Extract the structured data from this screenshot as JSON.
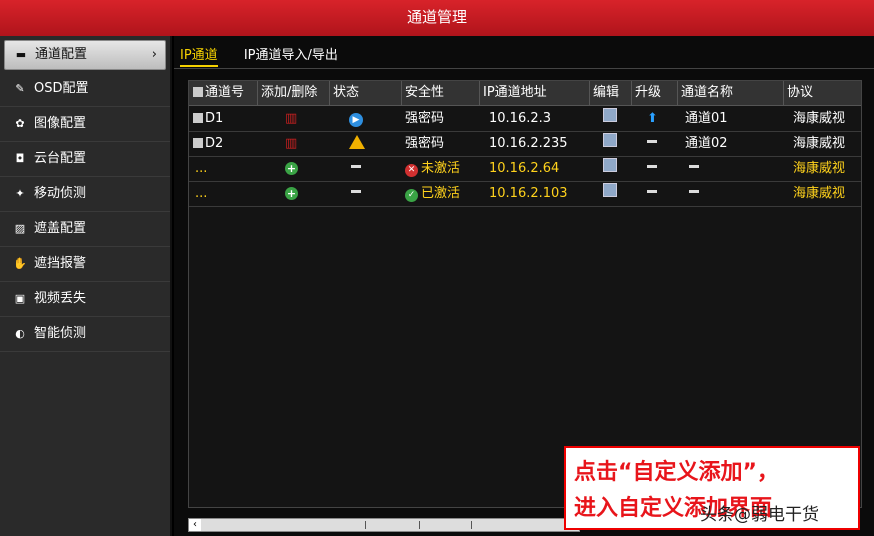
{
  "window": {
    "title": "通道管理"
  },
  "sidebar": {
    "items": [
      {
        "label": "通道配置",
        "icon": "camera-icon",
        "active": true
      },
      {
        "label": "OSD配置",
        "icon": "osd-icon"
      },
      {
        "label": "图像配置",
        "icon": "image-icon"
      },
      {
        "label": "云台配置",
        "icon": "ptz-icon"
      },
      {
        "label": "移动侦测",
        "icon": "motion-icon"
      },
      {
        "label": "遮盖配置",
        "icon": "mask-icon"
      },
      {
        "label": "遮挡报警",
        "icon": "tamper-icon"
      },
      {
        "label": "视频丢失",
        "icon": "video-loss-icon"
      },
      {
        "label": "智能侦测",
        "icon": "smart-icon"
      }
    ],
    "arrow": "›"
  },
  "tabs": [
    {
      "label": "IP通道",
      "active": true
    },
    {
      "label": "IP通道导入/导出"
    }
  ],
  "table": {
    "headers": [
      "通道号",
      "添加/删除",
      "状态",
      "安全性",
      "IP通道地址",
      "编辑",
      "升级",
      "通道名称",
      "协议"
    ],
    "rows": [
      {
        "channel": "D1",
        "security": "强密码",
        "ip": "10.16.2.3",
        "name": "通道01",
        "protocol": "海康威视",
        "status": "play"
      },
      {
        "channel": "D2",
        "security": "强密码",
        "ip": "10.16.2.235",
        "name": "通道02",
        "protocol": "海康威视",
        "status": "warn"
      },
      {
        "channel": "...",
        "security": "未激活",
        "ip": "10.16.2.64",
        "name": "",
        "protocol": "海康威视",
        "status": "none"
      },
      {
        "channel": "...",
        "security": "已激活",
        "ip": "10.16.2.103",
        "name": "",
        "protocol": "海康威视",
        "status": "none"
      }
    ]
  },
  "scrollbar": {
    "left_arrow": "‹"
  },
  "callout": {
    "line1": "点击“自定义添加”，",
    "line2": "进入自定义添加界面"
  },
  "watermark": "头条@弱电干货",
  "colors": {
    "title_red": "#c61a21",
    "active_yellow": "#f6d200",
    "callout_red": "#e8151b"
  }
}
